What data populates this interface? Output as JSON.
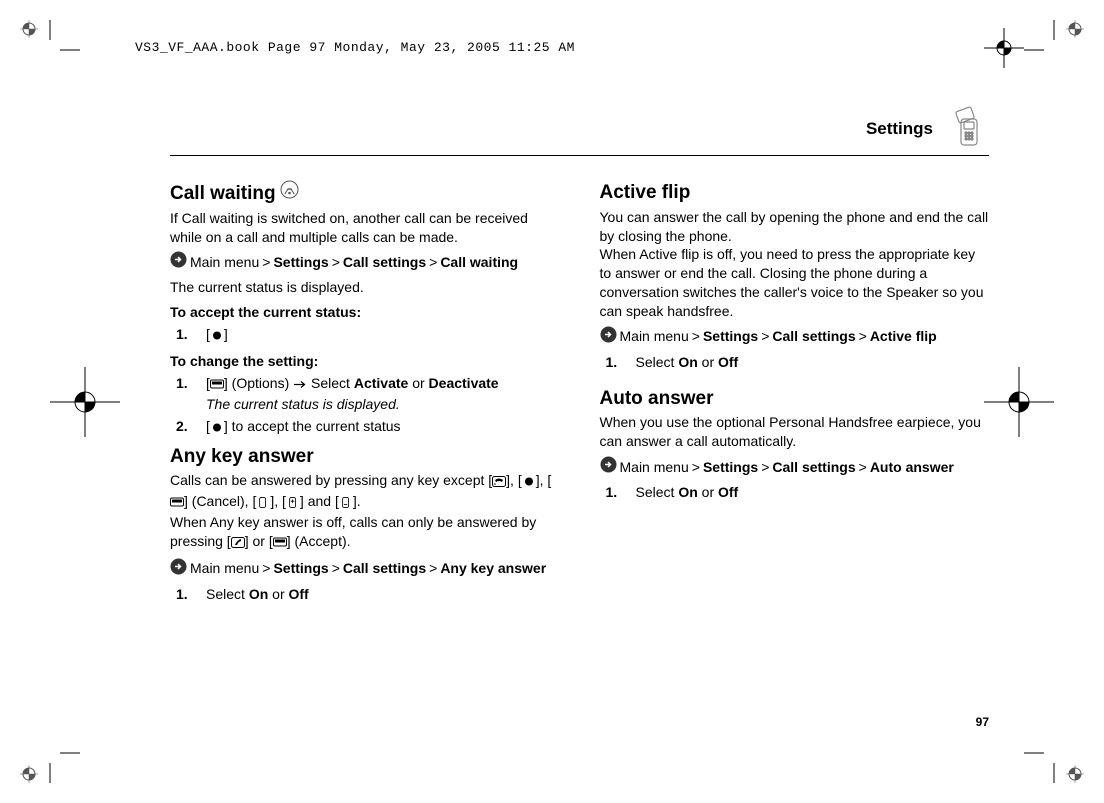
{
  "header_stamp": "VS3_VF_AAA.book  Page 97  Monday, May 23, 2005  11:25 AM",
  "page_title": "Settings",
  "page_number": "97",
  "call_waiting": {
    "heading": "Call waiting",
    "intro": "If Call waiting is switched on, another call can be received while on a call and multiple calls can be made.",
    "nav_prefix": "Main menu",
    "nav_settings": "Settings",
    "nav_callsettings": "Call settings",
    "nav_target": "Call waiting",
    "status_line": "The current status is displayed.",
    "accept_label": "To accept the current status:",
    "step1_num": "1.",
    "change_label": "To change the setting:",
    "change_step1_num": "1.",
    "change_step1_options": "(Options)",
    "change_step1_select": "Select",
    "change_step1_act": "Activate",
    "change_step1_or": "or",
    "change_step1_deact": "Deactivate",
    "change_step1_note": "The current status is displayed.",
    "change_step2_num": "2.",
    "change_step2_text": "to accept the current status"
  },
  "any_key": {
    "heading": "Any key answer",
    "intro1_a": "Calls can be answered by pressing any key except [",
    "intro1_b": "], [",
    "intro1_c": "], [",
    "intro1_cancel": "] (Cancel), [",
    "intro1_d": "], [",
    "intro1_e": "] and [",
    "intro1_f": "].",
    "intro2_a": "When Any key answer is off, calls can only be answered by pressing [",
    "intro2_b": "] or [",
    "intro2_accept": "] (Accept).",
    "nav_prefix": "Main menu",
    "nav_settings": "Settings",
    "nav_callsettings": "Call settings",
    "nav_target": "Any key answer",
    "step1_num": "1.",
    "step1_select": "Select",
    "step1_on": "On",
    "step1_or": "or",
    "step1_off": "Off"
  },
  "active_flip": {
    "heading": "Active flip",
    "intro1": "You can answer the call by opening the phone and end the call by closing the phone.",
    "intro2": "When Active flip is off, you need to press the appropriate key to answer or end the call. Closing the phone during a conversation switches the caller's voice to the Speaker so you can speak handsfree.",
    "nav_prefix": "Main menu",
    "nav_settings": "Settings",
    "nav_callsettings": "Call settings",
    "nav_target": "Active flip",
    "step1_num": "1.",
    "step1_select": "Select",
    "step1_on": "On",
    "step1_or": "or",
    "step1_off": "Off"
  },
  "auto_answer": {
    "heading": "Auto answer",
    "intro": "When you use the optional Personal Handsfree earpiece, you can answer a call automatically.",
    "nav_prefix": "Main menu",
    "nav_settings": "Settings",
    "nav_callsettings": "Call settings",
    "nav_target": "Auto answer",
    "step1_num": "1.",
    "step1_select": "Select",
    "step1_on": "On",
    "step1_or": "or",
    "step1_off": "Off"
  }
}
